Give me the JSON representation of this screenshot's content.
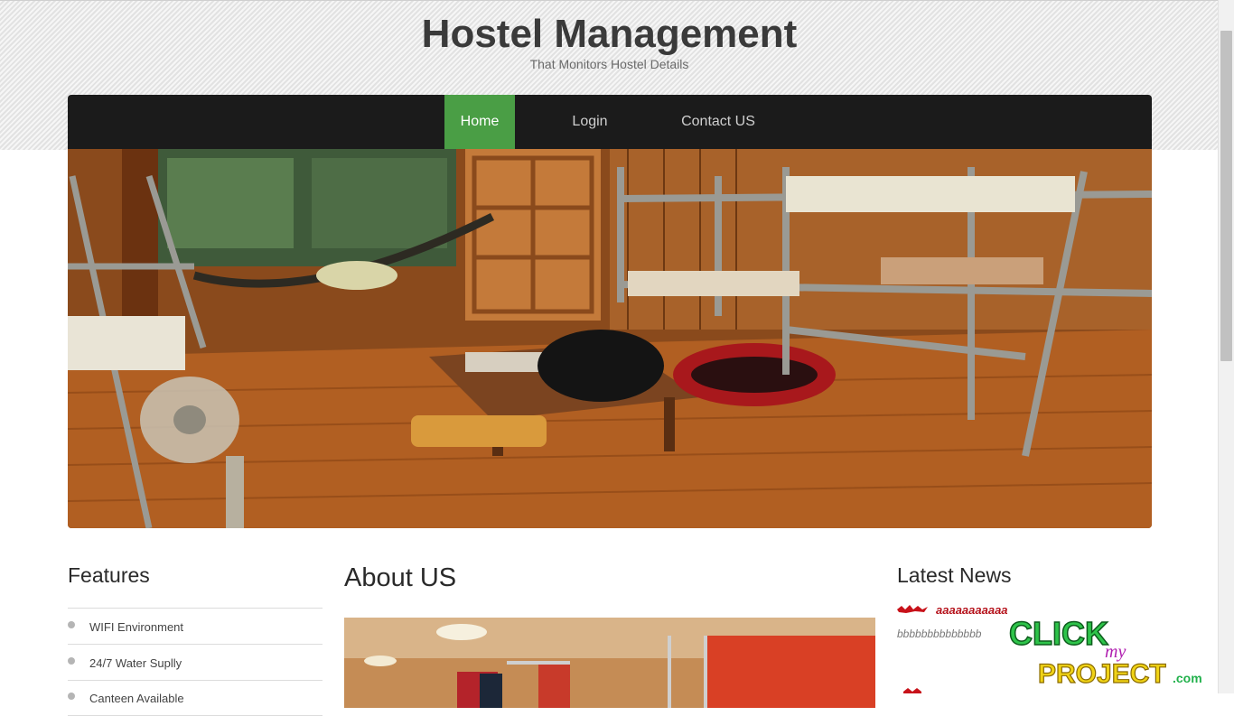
{
  "header": {
    "title": "Hostel Management",
    "tagline": "That Monitors Hostel Details"
  },
  "nav": {
    "home": "Home",
    "login": "Login",
    "contact": "Contact US",
    "active_color": "#4a9e45"
  },
  "features": {
    "title": "Features",
    "items": [
      "WIFI Environment",
      "24/7 Water Suplly",
      "Canteen Available"
    ]
  },
  "about": {
    "title": "About US"
  },
  "news": {
    "title": "Latest News",
    "headline": "aaaaaaaaaaa",
    "body": "bbbbbbbbbbbbbb"
  },
  "watermark": {
    "line1": "CLICK",
    "line2": "my",
    "line3": "PROJECT",
    "suffix": ".com"
  }
}
